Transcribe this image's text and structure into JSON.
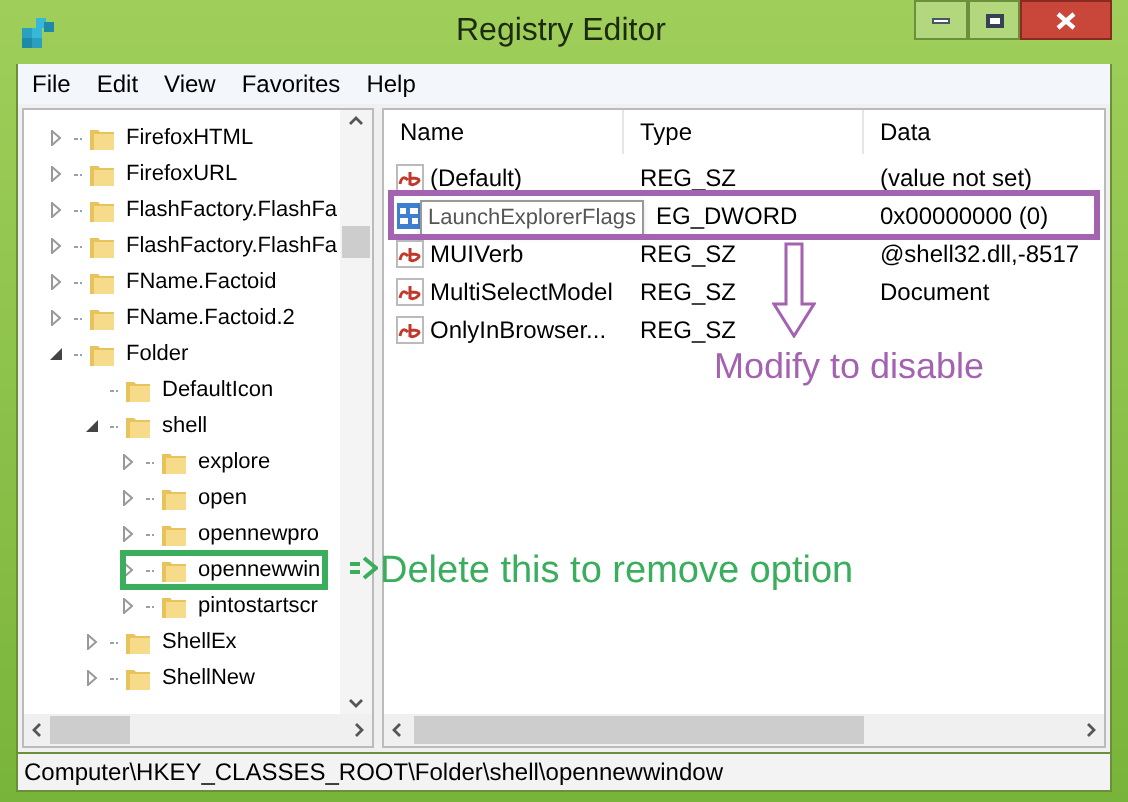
{
  "window": {
    "title": "Registry Editor"
  },
  "menu": [
    "File",
    "Edit",
    "View",
    "Favorites",
    "Help"
  ],
  "tree": [
    {
      "label": "FirefoxHTML",
      "kind": "branch",
      "expanded": false
    },
    {
      "label": "FirefoxURL",
      "kind": "branch",
      "expanded": false
    },
    {
      "label": "FlashFactory.FlashFa",
      "kind": "branch",
      "expanded": false
    },
    {
      "label": "FlashFactory.FlashFa",
      "kind": "branch",
      "expanded": false
    },
    {
      "label": "FName.Factoid",
      "kind": "branch",
      "expanded": false
    },
    {
      "label": "FName.Factoid.2",
      "kind": "branch",
      "expanded": false
    },
    {
      "label": "Folder",
      "kind": "branch",
      "expanded": true,
      "children": [
        {
          "label": "DefaultIcon",
          "kind": "leaf"
        },
        {
          "label": "shell",
          "kind": "branch",
          "expanded": true,
          "children": [
            {
              "label": "explore",
              "kind": "branch",
              "expanded": false
            },
            {
              "label": "open",
              "kind": "branch",
              "expanded": false
            },
            {
              "label": "opennewpro",
              "kind": "branch",
              "expanded": false
            },
            {
              "label": "opennewwin",
              "kind": "branch",
              "expanded": false,
              "marked": true
            },
            {
              "label": "pintostartscr",
              "kind": "branch",
              "expanded": false
            }
          ]
        },
        {
          "label": "ShellEx",
          "kind": "branch",
          "expanded": false
        },
        {
          "label": "ShellNew",
          "kind": "branch",
          "expanded": false
        }
      ]
    }
  ],
  "table": {
    "columns": [
      "Name",
      "Type",
      "Data"
    ],
    "rows": [
      {
        "kind": "string",
        "name": "(Default)",
        "type": "REG_SZ",
        "data": "(value not set)",
        "marked": false
      },
      {
        "kind": "binary",
        "tooltip": "LaunchExplorerFlags",
        "type": "EG_DWORD",
        "data": "0x00000000 (0)",
        "marked": true
      },
      {
        "kind": "string",
        "name": "MUIVerb",
        "type": "REG_SZ",
        "data": "@shell32.dll,-8517",
        "marked": false
      },
      {
        "kind": "string",
        "name": "MultiSelectModel",
        "type": "REG_SZ",
        "data": "Document",
        "marked": false
      },
      {
        "kind": "string",
        "name": "OnlyInBrowser...",
        "type": "REG_SZ",
        "marked": false
      }
    ]
  },
  "annotations": {
    "value": {
      "text": "Modify to disable",
      "color": "#a463b0"
    },
    "tree": {
      "text": "Delete this to remove option",
      "color": "#3aae5c"
    }
  },
  "status_bar": "Computer\\HKEY_CLASSES_ROOT\\Folder\\shell\\opennewwindow"
}
